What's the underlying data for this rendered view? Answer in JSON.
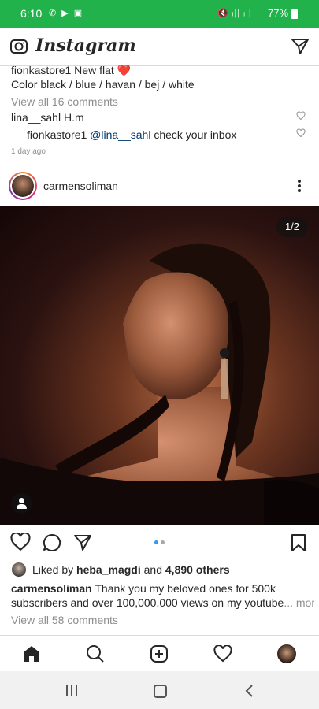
{
  "status_bar": {
    "time": "6:10",
    "battery": "77%"
  },
  "header": {
    "app_name": "Instagram"
  },
  "prev_post": {
    "caption_user": "fionkastore1",
    "caption_text": "New flat ❤️",
    "caption_line2": "Color black / blue / havan / bej / white",
    "view_comments": "View all 16 comments",
    "comment1_user": "lina__sahl",
    "comment1_text": "H.m",
    "reply_user": "fionkastore1",
    "reply_mention": "@lina__sahl",
    "reply_text": "check your inbox",
    "time_ago": "1 day ago"
  },
  "post": {
    "username": "carmensoliman",
    "image_counter": "1/2",
    "current_slide": 1,
    "total_slides": 2,
    "liked_prefix": "Liked by",
    "liked_user": "heba_magdi",
    "liked_and": "and",
    "liked_others": "4,890 others",
    "caption_user": "carmensoliman",
    "caption_line1": "Thank you my beloved ones for 500k",
    "caption_line2": "subscribers and over 100,000,000 views on my youtube",
    "caption_more": "... more",
    "view_comments": "View all 58 comments"
  },
  "bottom_nav": [
    "home",
    "search",
    "new-post",
    "activity",
    "profile"
  ],
  "colors": {
    "status_bar": "#22b24c",
    "like_heart": "#ed4956",
    "dot_active": "#3897f0",
    "mention": "#00376b"
  }
}
